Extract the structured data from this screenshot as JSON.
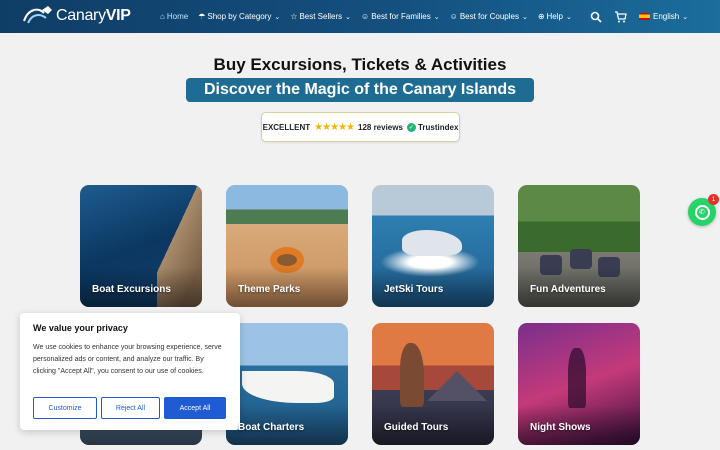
{
  "brand": {
    "name_light": "Canary",
    "name_bold": "VIP"
  },
  "nav": {
    "items": [
      {
        "label": "Home",
        "icon": "home-icon",
        "active": true
      },
      {
        "label": "Shop by Category",
        "icon": "umbrella-icon",
        "chevron": true
      },
      {
        "label": "Best Sellers",
        "icon": "star-icon",
        "chevron": true
      },
      {
        "label": "Best for Families",
        "icon": "family-icon",
        "chevron": true
      },
      {
        "label": "Best for Couples",
        "icon": "couple-icon",
        "chevron": true
      },
      {
        "label": "Help",
        "icon": "globe-icon",
        "chevron": true
      }
    ],
    "language": "English"
  },
  "hero": {
    "title": "Buy Excursions, Tickets & Activities",
    "subtitle": "Discover the Magic of the Canary Islands"
  },
  "trust": {
    "rating_label": "EXCELLENT",
    "stars": "★★★★★",
    "reviews": "128 reviews",
    "provider": "Trustindex"
  },
  "cards": [
    {
      "label": "Boat Excursions"
    },
    {
      "label": "Theme Parks"
    },
    {
      "label": "JetSki Tours"
    },
    {
      "label": "Fun Adventures"
    },
    {
      "label": ""
    },
    {
      "label": "Boat Charters"
    },
    {
      "label": "Guided Tours"
    },
    {
      "label": "Night Shows"
    }
  ],
  "whatsapp": {
    "badge": "1"
  },
  "cookie": {
    "title": "We value your privacy",
    "text": "We use cookies to enhance your browsing experience, serve personalized ads or content, and analyze our traffic. By clicking \"Accept All\", you consent to our use of cookies.",
    "customize": "Customize",
    "reject": "Reject All",
    "accept": "Accept All"
  },
  "colors": {
    "nav": "#14507f",
    "subtitle_bg": "#1e6c94",
    "cookie_button": "#1f5bd2",
    "whatsapp": "#25d366"
  }
}
